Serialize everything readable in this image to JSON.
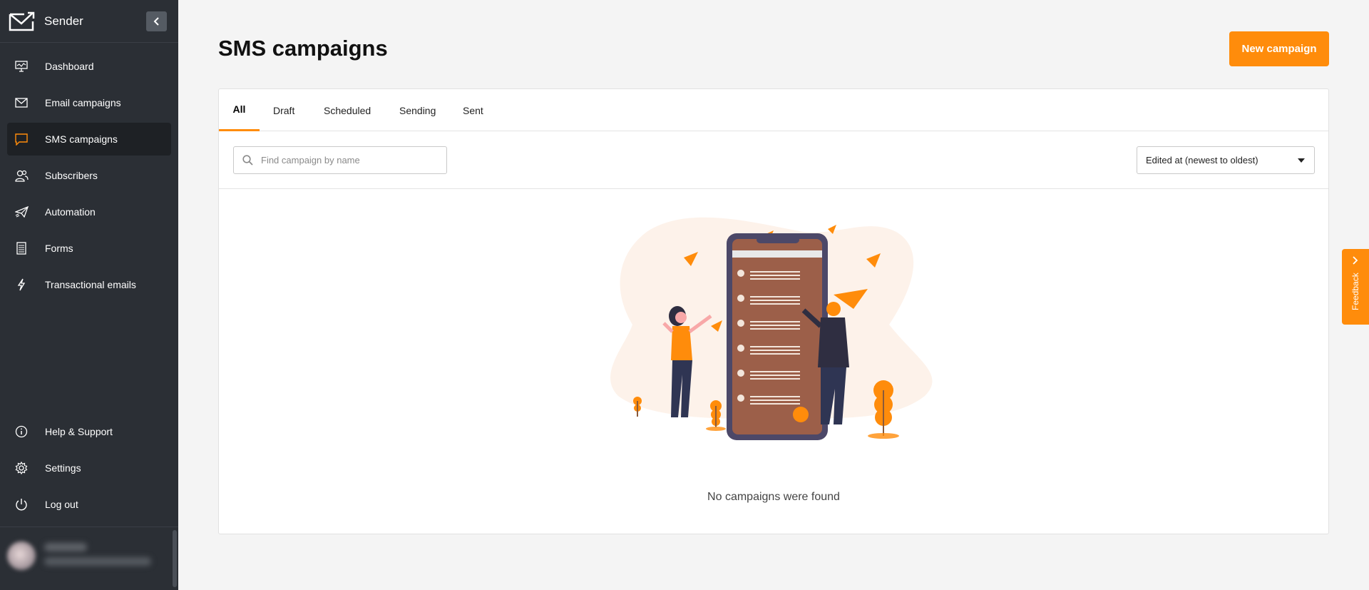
{
  "brand": {
    "name": "Sender"
  },
  "sidebar": {
    "items": [
      {
        "label": "Dashboard",
        "icon": "monitor-icon"
      },
      {
        "label": "Email campaigns",
        "icon": "envelope-icon"
      },
      {
        "label": "SMS campaigns",
        "icon": "chat-bubble-icon",
        "active": true
      },
      {
        "label": "Subscribers",
        "icon": "users-icon"
      },
      {
        "label": "Automation",
        "icon": "paper-plane-icon"
      },
      {
        "label": "Forms",
        "icon": "form-icon"
      },
      {
        "label": "Transactional emails",
        "icon": "bolt-icon"
      }
    ],
    "bottom_items": [
      {
        "label": "Help & Support",
        "icon": "info-icon"
      },
      {
        "label": "Settings",
        "icon": "gear-icon"
      },
      {
        "label": "Log out",
        "icon": "power-icon"
      }
    ]
  },
  "page": {
    "title": "SMS campaigns",
    "new_button": "New campaign"
  },
  "tabs": [
    {
      "label": "All",
      "active": true
    },
    {
      "label": "Draft"
    },
    {
      "label": "Scheduled"
    },
    {
      "label": "Sending"
    },
    {
      "label": "Sent"
    }
  ],
  "search": {
    "placeholder": "Find campaign by name",
    "value": ""
  },
  "sort": {
    "selected": "Edited at (newest to oldest)"
  },
  "empty_state": {
    "message": "No campaigns were found"
  },
  "feedback": {
    "label": "Feedback"
  },
  "colors": {
    "accent": "#ff8c0b",
    "sidebar_bg": "#2b2f35",
    "active_item_bg": "#1e2125"
  }
}
